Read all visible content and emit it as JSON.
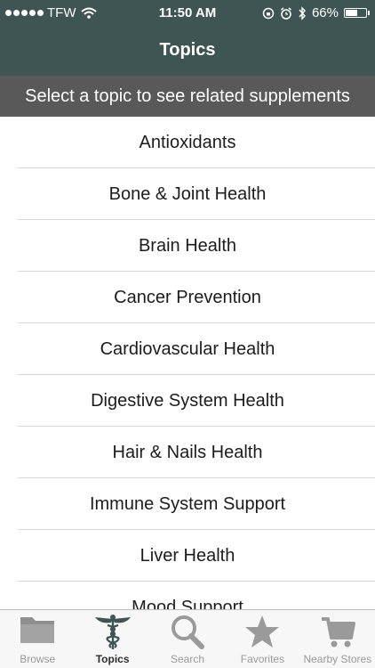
{
  "status_bar": {
    "carrier": "TFW",
    "time": "11:50 AM",
    "battery_percent": "66%",
    "battery_level": 0.66
  },
  "nav": {
    "title": "Topics"
  },
  "subheader": "Select a topic to see related supplements",
  "topics": [
    "Antioxidants",
    "Bone & Joint Health",
    "Brain Health",
    "Cancer Prevention",
    "Cardiovascular Health",
    "Digestive System Health",
    "Hair & Nails Health",
    "Immune System Support",
    "Liver Health",
    "Mood Support"
  ],
  "tabs": [
    {
      "label": "Browse",
      "icon": "folder-icon",
      "active": false
    },
    {
      "label": "Topics",
      "icon": "caduceus-icon",
      "active": true
    },
    {
      "label": "Search",
      "icon": "magnifier-icon",
      "active": false
    },
    {
      "label": "Favorites",
      "icon": "star-icon",
      "active": false
    },
    {
      "label": "Nearby Stores",
      "icon": "cart-icon",
      "active": false
    }
  ],
  "colors": {
    "bar": "#3f5553",
    "subheader": "#595959",
    "tab_inactive": "#9a9a9a",
    "tab_active": "#2d2d2d"
  }
}
